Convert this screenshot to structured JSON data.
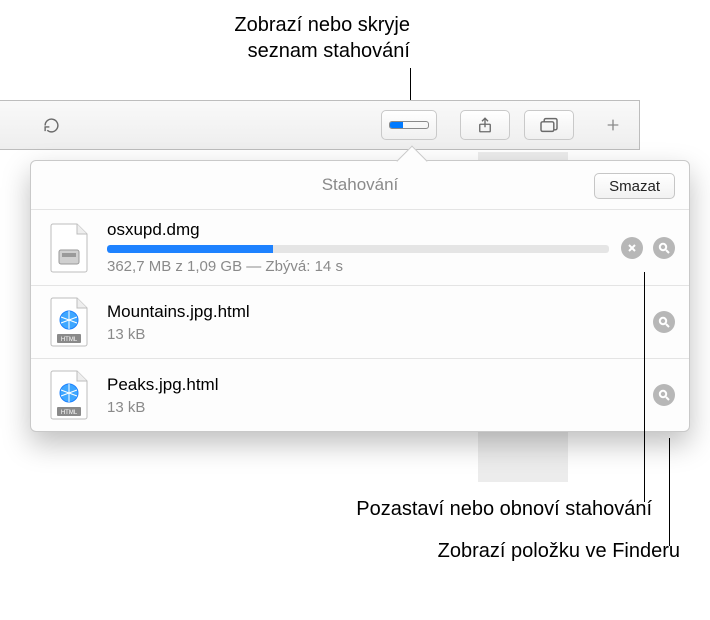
{
  "annotations": {
    "toggle_downloads_line1": "Zobrazí nebo skryje",
    "toggle_downloads_line2": "seznam stahování",
    "pause_resume": "Pozastaví nebo obnoví stahování",
    "show_in_finder": "Zobrazí položku ve Finderu"
  },
  "toolbar": {
    "download_mini_progress_percent": 35,
    "icons": {
      "reload": "reload-icon",
      "share": "share-icon",
      "tabs": "tabs-icon",
      "newtab": "plus-icon"
    }
  },
  "popover": {
    "title": "Stahování",
    "clear_label": "Smazat"
  },
  "downloads": [
    {
      "name": "osxupd.dmg",
      "meta": "362,7 MB z 1,09 GB — Zbývá: 14 s",
      "progress_percent": 33,
      "in_progress": true,
      "icon": "dmg"
    },
    {
      "name": "Mountains.jpg.html",
      "meta": "13 kB",
      "in_progress": false,
      "icon": "html"
    },
    {
      "name": "Peaks.jpg.html",
      "meta": "13 kB",
      "in_progress": false,
      "icon": "html"
    }
  ]
}
